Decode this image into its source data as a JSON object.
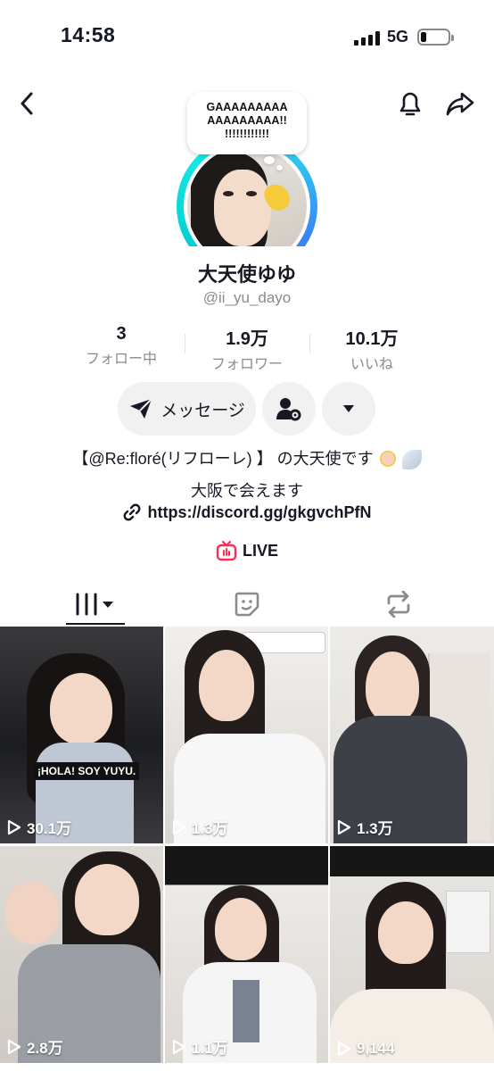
{
  "status_bar": {
    "time": "14:58",
    "network": "5G"
  },
  "profile": {
    "speech_bubble": "GAAAAAAAAA\nAAAAAAAAA!!\n!!!!!!!!!!!!",
    "name": "大天使ゆゆ",
    "handle": "@ii_yu_dayo"
  },
  "stats": [
    {
      "value": "3",
      "label": "フォロー中"
    },
    {
      "value": "1.9万",
      "label": "フォロワー"
    },
    {
      "value": "10.1万",
      "label": "いいね"
    }
  ],
  "actions": {
    "message_label": "メッセージ"
  },
  "bio": {
    "line1": "【@Re:floré(リフローレ) 】 の大天使です",
    "line2": "大阪で会えます",
    "link": "https://discord.gg/gkgvchPfN"
  },
  "live_label": "LIVE",
  "videos": [
    {
      "views": "30.1万",
      "caption": "¡HOLA! SOY YUYU."
    },
    {
      "views": "1.3万"
    },
    {
      "views": "1.3万"
    },
    {
      "views": "2.8万"
    },
    {
      "views": "1.1万"
    },
    {
      "views": "9,144"
    }
  ],
  "colors": {
    "live_accent": "#fe2c55",
    "ring_start": "#25f4ee",
    "ring_end": "#3b82f6",
    "muted_text": "#8a8b91"
  }
}
